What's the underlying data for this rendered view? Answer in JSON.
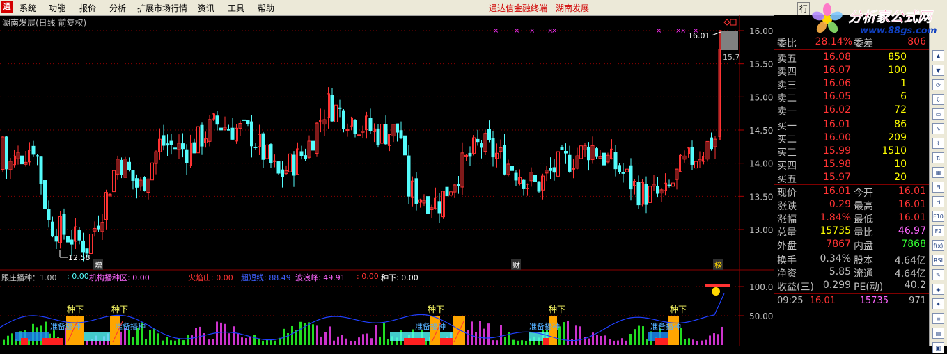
{
  "menu": {
    "items": [
      "系统",
      "功能",
      "报价",
      "分析",
      "扩展市场行情",
      "资讯",
      "工具",
      "帮助"
    ],
    "app_title": "通达信金融终端",
    "stock_title": "湖南发展",
    "cut_button": "行"
  },
  "watermark": {
    "brand": "分析家公式网",
    "url": "www.88gs.com"
  },
  "chart": {
    "title": "湖南发展(日线 前复权)",
    "price_axis": [
      "16.00",
      "15.50",
      "15.00",
      "14.50",
      "14.00",
      "13.50",
      "13.00"
    ],
    "high_marker": "16.01",
    "low_marker": "12.58",
    "current_marker": "15.7",
    "event_labels": [
      "增",
      "财",
      "榜"
    ],
    "colors": {
      "up": "#FF3333",
      "down": "#54FCFC",
      "grid": "#8B0000",
      "line": "#2040FF"
    }
  },
  "indicator": {
    "legend": [
      {
        "text": "跟庄播种：1.00",
        "color": "#C0C0C0"
      },
      {
        "text": ": 0.00",
        "color": "#54FCFC"
      },
      {
        "text": "机构播种区: 0.00",
        "color": "#FF66FF"
      },
      {
        "text": "火焰山: 0.00",
        "color": "#FF3333"
      },
      {
        "text": "超短线: 88.49",
        "color": "#4060FF"
      },
      {
        "text": "波浪峰: 49.91",
        "color": "#FF66FF"
      },
      {
        "text": ": 0.00",
        "color": "#FF3333"
      },
      {
        "text": "种下: 0.00",
        "color": "#FFFFFF"
      }
    ],
    "axis": [
      "100.0",
      "50.00"
    ],
    "seed_label": "种下",
    "ready_label": "准备播种"
  },
  "quote": {
    "header": {
      "label1": "委比",
      "value1": "28.14%",
      "label2": "委差",
      "value2": "806"
    },
    "sell": [
      {
        "label": "卖五",
        "price": "16.08",
        "vol": "850"
      },
      {
        "label": "卖四",
        "price": "16.07",
        "vol": "100"
      },
      {
        "label": "卖三",
        "price": "16.06",
        "vol": "1"
      },
      {
        "label": "卖二",
        "price": "16.05",
        "vol": "6"
      },
      {
        "label": "卖一",
        "price": "16.02",
        "vol": "72"
      }
    ],
    "buy": [
      {
        "label": "买一",
        "price": "16.01",
        "vol": "86"
      },
      {
        "label": "买二",
        "price": "16.00",
        "vol": "209"
      },
      {
        "label": "买三",
        "price": "15.99",
        "vol": "1510"
      },
      {
        "label": "买四",
        "price": "15.98",
        "vol": "10"
      },
      {
        "label": "买五",
        "price": "15.97",
        "vol": "20"
      }
    ],
    "stats": [
      {
        "l1": "现价",
        "v1": "16.01",
        "c1": "#FF3333",
        "l2": "今开",
        "v2": "16.01",
        "c2": "#FF3333"
      },
      {
        "l1": "涨跌",
        "v1": "0.29",
        "c1": "#FF3333",
        "l2": "最高",
        "v2": "16.01",
        "c2": "#FF3333"
      },
      {
        "l1": "涨幅",
        "v1": "1.84%",
        "c1": "#FF3333",
        "l2": "最低",
        "v2": "16.01",
        "c2": "#FF3333"
      },
      {
        "l1": "总量",
        "v1": "15735",
        "c1": "#FFFF00",
        "l2": "量比",
        "v2": "46.97",
        "c2": "#FF66FF"
      },
      {
        "l1": "外盘",
        "v1": "7867",
        "c1": "#FF3333",
        "l2": "内盘",
        "v2": "7868",
        "c2": "#33FF33"
      }
    ],
    "stats2": [
      {
        "l1": "换手",
        "v1": "0.34%",
        "c1": "#C0C0C0",
        "l2": "股本",
        "v2": "4.64亿",
        "c2": "#C0C0C0"
      },
      {
        "l1": "净资",
        "v1": "5.85",
        "c1": "#C0C0C0",
        "l2": "流通",
        "v2": "4.64亿",
        "c2": "#C0C0C0"
      },
      {
        "l1": "收益(三)",
        "v1": "0.299",
        "c1": "#C0C0C0",
        "l2": "PE(动)",
        "v2": "40.2",
        "c2": "#C0C0C0"
      }
    ],
    "tick": {
      "time": "09:25",
      "price": "16.01",
      "vol": "15735",
      "num": "971"
    }
  },
  "toolbar": [
    "▲",
    "▼",
    "⟳",
    "⇩",
    "▭",
    "∿",
    "⌇",
    "⇅",
    "▦",
    "Fi",
    "Fi",
    "F10",
    "F2",
    "f(x)",
    "RSI",
    "✎",
    "◈",
    "✦",
    "≡",
    "▤",
    "▣"
  ]
}
